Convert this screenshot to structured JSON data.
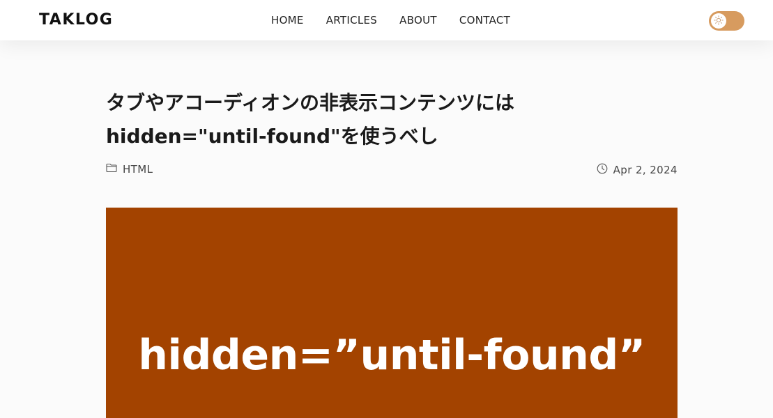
{
  "header": {
    "logo": "TAKLOG",
    "nav": [
      "HOME",
      "ARTICLES",
      "ABOUT",
      "CONTACT"
    ],
    "theme_toggle_icon": "sun-icon"
  },
  "article": {
    "title": "タブやアコーディオンの非表示コンテンツには hidden=\"until-found\"を使うべし",
    "category_icon": "folder-icon",
    "category": "HTML",
    "date_icon": "clock-icon",
    "date": "Apr 2, 2024",
    "hero_text": "hidden=”until-found”"
  },
  "colors": {
    "hero_background": "#a34300",
    "toggle_background": "#d79b5f"
  }
}
